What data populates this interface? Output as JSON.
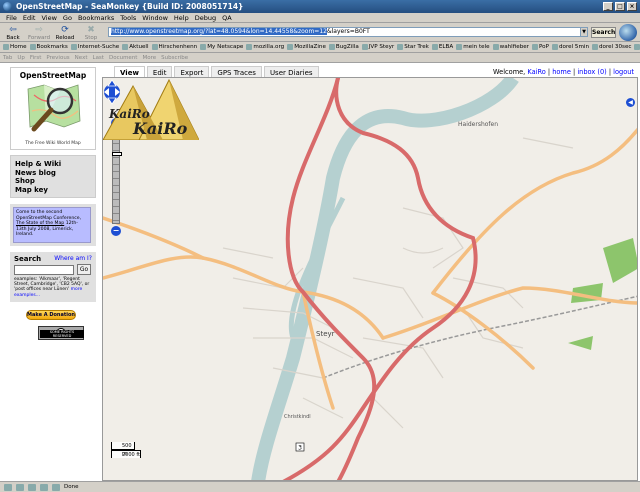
{
  "window": {
    "title": "OpenStreetMap - SeaMonkey {Build ID: 2008051714}"
  },
  "menu": [
    "File",
    "Edit",
    "View",
    "Go",
    "Bookmarks",
    "Tools",
    "Window",
    "Help",
    "Debug",
    "QA"
  ],
  "navigation": {
    "buttons": [
      {
        "label": "Back",
        "glyph": "⇦",
        "enabled": true
      },
      {
        "label": "Forward",
        "glyph": "⇨",
        "enabled": false
      },
      {
        "label": "Reload",
        "glyph": "⟳",
        "enabled": true
      },
      {
        "label": "Stop",
        "glyph": "✖",
        "enabled": false
      }
    ],
    "url_selected": "http://www.openstreetmap.org/?lat=48.0594&lon=14.44558&zoom=12",
    "url_rest": "&layers=B0FT",
    "search_label": "Search"
  },
  "bookmarks": [
    "Home",
    "Bookmarks",
    "Internet-Suche",
    "Aktuell",
    "Hirschenhenn",
    "My Netscape",
    "mozilla.org",
    "MozillaZine",
    "BugZilla",
    "JVP Steyr",
    "Star Trek",
    "ELBA",
    "mein tele",
    "wahlfieber",
    "PoP",
    "dorel 5min",
    "dorel 30sec",
    "H2O"
  ],
  "tabbar": [
    "Tab",
    "Up",
    "First",
    "Previous",
    "Next",
    "Last",
    "Document",
    "More",
    "Subscribe"
  ],
  "sidebar": {
    "logo_title": "OpenStreetMap",
    "logo_caption": "The Free Wiki World Map",
    "nav_links": [
      "Help & Wiki",
      "News blog",
      "Shop",
      "Map key"
    ],
    "notice": {
      "line1": "Come to the second OpenStreetMap Conference,",
      "link": "The State of the Map",
      "line2": "12th-13th July 2008, Limerick, Ireland."
    },
    "search": {
      "title": "Search",
      "where_link": "Where am I?",
      "go_label": "Go",
      "examples": "examples: 'Alkmaar', 'Regent Street, Cambridge', 'CB2 5AQ', or 'post offices near Lünen'",
      "more": "more examples..."
    },
    "donate_label": "Make A Donation",
    "cc_label": "SOME RIGHTS RESERVED"
  },
  "content_tabs": [
    {
      "label": "View",
      "active": true
    },
    {
      "label": "Edit",
      "active": false
    },
    {
      "label": "Export",
      "active": false
    },
    {
      "label": "GPS Traces",
      "active": false
    },
    {
      "label": "User Diaries",
      "active": false
    }
  ],
  "user_bar": {
    "welcome": "Welcome,",
    "user": "KaiRo",
    "home": "home",
    "inbox": "inbox (0)",
    "logout": "logout"
  },
  "map": {
    "labels": {
      "haidershofen": "Haidershofen",
      "steyr": "Steyr",
      "christkindl": "Christkindl",
      "road_shield": "3"
    },
    "scale_top": "500 m",
    "scale_bottom": "2000 ft",
    "colors": {
      "background": "#f1eee8",
      "river": "#b5d0d0",
      "primary_road": "#d86a6a",
      "secondary_road": "#f4be80",
      "forest": "#8dc56c"
    },
    "watermark": "KaiRo"
  },
  "status": {
    "text": "Done"
  }
}
